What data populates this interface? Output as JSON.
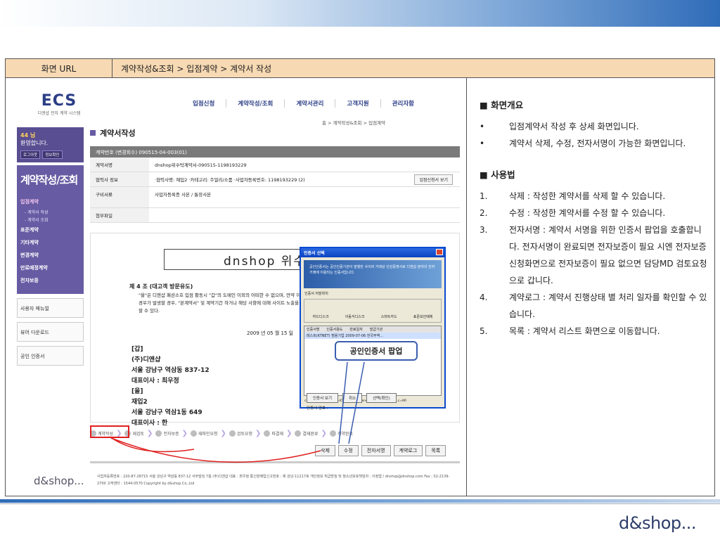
{
  "header": {
    "label": "화면 URL",
    "path": "계약작성&조회 > 입점계약 > 계약서 작성"
  },
  "screenshot": {
    "app_logo": "ECS",
    "app_sub": "디앤샵 전자 계약 시스템",
    "gnb": [
      "입점신청",
      "계약작성/조회",
      "계약서관리",
      "고객지원",
      "관리자함"
    ],
    "login": {
      "count": "44 님",
      "welcome": "환영합니다.",
      "btn1": "로그아웃",
      "btn2": "정보확인"
    },
    "section_title": "계약작성/조회",
    "menu": [
      "입점계약",
      "표준계약",
      "기타계약",
      "변경계약",
      "만료예정계약",
      "전자보증"
    ],
    "submenu": [
      "- 계약서 작성",
      "- 계약서 조회"
    ],
    "quick": [
      "사용자 매뉴얼",
      "뷰어 다운로드",
      "공인 인증서"
    ],
    "page_title": "계약서작성",
    "breadcrumb": "홈 > 계약작성&조회 > 입점계약",
    "contract_no": "계약번호 (변경회수)    090515-04-003(01)",
    "rows": [
      {
        "k": "계약서명",
        "v": "dnshop위수탁계약서-090515-1198193229"
      },
      {
        "k": "협력사 정보",
        "v": "·협력사명: 재입2   ·카테고리: 주얼리/소품   ·사업자등록번호: 1198193229 (2)"
      },
      {
        "k": "구비서류",
        "v": "사업자등록증 사본 / 통장사본"
      },
      {
        "k": "첨부파일",
        "v": ""
      }
    ],
    "view_button": "입점신청서 보기",
    "doc_title": "dnshop 위수탁거래",
    "article": "제 4 조 (대고객 방문유도)",
    "article_text": "\"을\"은 디앤샵 패션소호 입점 활동시 \"갑\"의 도메인 이외의 어떠한 수 없으며, 만약 이러한 경우가 발생할 경우, \"본계약서\" 및 계약기간 하거나 해당 사항에 대해 사이트 노출을 제재 할 수 있다.",
    "date": "2009 년 05 월 15 일",
    "party": [
      "[갑]",
      "(주)디앤샵",
      "서울 강남구 역삼동 837-12",
      "대표이사 : 최우정",
      "[을]",
      "재입2",
      "서울 강남구 역삼1동 649",
      "대표이사 : 한"
    ],
    "steps": [
      "계약작성",
      "재검토",
      "전자보증",
      "재파인요청",
      "검토요청",
      "파결재",
      "결재완료",
      "계약완료"
    ],
    "actions": [
      "삭제",
      "수정",
      "전자서명",
      "계약로그",
      "목록"
    ],
    "footer_logo": "d&shop...",
    "footer_text": "사업자등록번호 : 220-87-28715  서울 강남구 역삼동 837-12 서부빌딩 7층 (주)디앤샵  대표 : 최우정  통신판매업신고번호 : 제 강남-11217호  개인정보 취급방침 및 청소년보호책임자 : 이정엽 / dnshop@dnshop.com Fax : 02-2139-2700 고객센터 : 1544-0570 Copyright by d&shop.Co.,Ltd",
    "dialog": {
      "title": "인증서 선택",
      "banner": "공인인증서는 공인인증기관이 발행한 사이버 거래상 인감증명서로 디앤샵 분야의 전자거래에 이용되는 인증서입니다.",
      "loc_label": "인증서 저장위치",
      "locs": [
        "하드디스크",
        "이동식디스크",
        "스마트카드",
        "표준보안매체"
      ],
      "cols": [
        "인증서명",
        "인증서용도",
        "만료일자",
        "발급기관"
      ],
      "row": "테스트(KTNET)   범용기업   2009-07-06   한국무역…",
      "dn": "cn=테스트(KTNET),ou=KTNET,ou=LicensedCA,o=TradeSign,c=KR",
      "pw_label": "인증서 암호 :",
      "buttons": [
        "인증서 보기",
        "취소",
        "선택(확인)"
      ]
    },
    "callout": "공인인증서 팝업"
  },
  "overview": {
    "title": "■ 화면개요",
    "items": [
      "입점계약서 작성 후 상세 화면입니다.",
      "계약서 삭제, 수정, 전자서명이 가능한 화면입니다."
    ]
  },
  "usage": {
    "title": "■ 사용법",
    "items": [
      "삭제 : 작성한 계약서를 삭제 할 수 있습니다.",
      "수정 : 작성한 계약서를 수정 할 수 있습니다.",
      "전자서명 : 계약서 서명을 위한 인증서 팝업을 호출합니다. 전자서명이 완료되면 전자보증이 필요 시엔 전자보증 신청화면으로 전자보증이 필요 없으면 담당MD 검토요청으로 갑니다.",
      "계약로그 : 계약서 진행상태 별 처리 일자를 확인할 수 있습니다.",
      "목록 : 계약서 리스트 화면으로 이동합니다."
    ]
  },
  "brand": "d&shop..."
}
